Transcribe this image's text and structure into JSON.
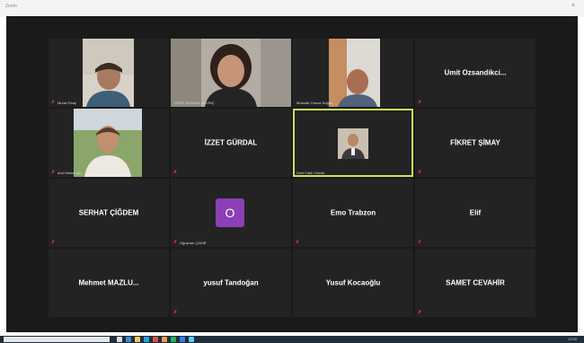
{
  "window": {
    "app_label": "Zoom",
    "close_glyph": "×"
  },
  "colors": {
    "active_speaker": "#c9e25a",
    "muted": "#e23b3b",
    "avatar_bg": "#8c3fb6"
  },
  "participants": [
    {
      "name": "Murat Ertaş",
      "display": "video",
      "muted": true
    },
    {
      "name": "İZZET GÜRDAL SEVİNÇ",
      "display": "video",
      "muted": false
    },
    {
      "name": "Mustafa Yılmaz Doğan",
      "display": "video",
      "muted": false
    },
    {
      "name": "Umit Ozsandikci...",
      "display": "name",
      "muted": true
    },
    {
      "name": "Anıl Hekimoğlu",
      "display": "video",
      "muted": true
    },
    {
      "name": "İZZET GÜRDAL",
      "display": "name",
      "muted": true
    },
    {
      "name": "Ümit Fatih Öztürk",
      "display": "video",
      "muted": false,
      "active": true
    },
    {
      "name": "FİKRET ŞİMAY",
      "display": "name",
      "muted": true
    },
    {
      "name": "SERHAT ÇİĞDEM",
      "display": "name",
      "muted": true
    },
    {
      "name": "Oğuzhan ÇAKIR",
      "display": "avatar",
      "initial": "O",
      "muted": true
    },
    {
      "name": "Emo Trabzon",
      "display": "name",
      "muted": true
    },
    {
      "name": "Elif",
      "display": "name",
      "muted": true
    },
    {
      "name": "Mehmet  MAZLU...",
      "display": "name",
      "muted": false
    },
    {
      "name": "yusuf Tandoğan",
      "display": "name",
      "muted": true
    },
    {
      "name": "Yusuf Kocaoğlu",
      "display": "name",
      "muted": false
    },
    {
      "name": "SAMET CEVAHİR",
      "display": "name",
      "muted": true
    }
  ],
  "taskbar": {
    "clock": "12:00"
  }
}
